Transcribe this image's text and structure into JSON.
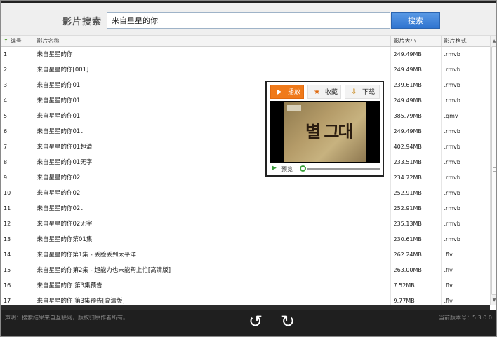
{
  "search": {
    "title": "影片搜索",
    "value": "来自星星的你",
    "button_label": "搜索"
  },
  "table": {
    "sort_icon": "↑",
    "headers": [
      "编号",
      "影片名称",
      "影片大小",
      "影片格式"
    ],
    "rows": [
      [
        "1",
        "来自星星的你",
        "249.49MB",
        ".rmvb"
      ],
      [
        "2",
        "来自星星的你[001]",
        "249.49MB",
        ".rmvb"
      ],
      [
        "3",
        "来自星星的你01",
        "239.61MB",
        ".rmvb"
      ],
      [
        "4",
        "来自星星的你01",
        "249.49MB",
        ".rmvb"
      ],
      [
        "5",
        "来自星星的你01",
        "385.79MB",
        ".qmv"
      ],
      [
        "6",
        "来自星星的你01t",
        "249.49MB",
        ".rmvb"
      ],
      [
        "7",
        "来自星星的你01超清",
        "402.94MB",
        ".rmvb"
      ],
      [
        "8",
        "来自星星的你01无字",
        "233.51MB",
        ".rmvb"
      ],
      [
        "9",
        "来自星星的你02",
        "234.72MB",
        ".rmvb"
      ],
      [
        "10",
        "来自星星的你02",
        "252.91MB",
        ".rmvb"
      ],
      [
        "11",
        "来自星星的你02t",
        "252.91MB",
        ".rmvb"
      ],
      [
        "12",
        "来自星星的你02无字",
        "235.13MB",
        ".rmvb"
      ],
      [
        "13",
        "来自星星的你第01集",
        "230.61MB",
        ".rmvb"
      ],
      [
        "14",
        "来自星星的你第1集 - 丢脸丢到太平洋",
        "262.24MB",
        ".flv"
      ],
      [
        "15",
        "来自星星的你第2集 - 超能力也未能帮上忙[高清版]",
        "263.00MB",
        ".flv"
      ],
      [
        "16",
        "来自星星的你 第3集预告",
        "7.52MB",
        ".flv"
      ],
      [
        "17",
        "来自星星的你 第3集预告[高清版]",
        "9.77MB",
        ".flv"
      ]
    ]
  },
  "popup": {
    "play_label": "播放",
    "favorite_label": "收藏",
    "download_label": "下载",
    "video_title": "별 그대",
    "preview_label": "预览",
    "play_icon": "▶",
    "favorite_icon": "★",
    "download_icon": "⇩",
    "preview_progress": 0
  },
  "footer": {
    "note": "声明：搜索结果来自互联网，版权归原作者所有。",
    "version": "当前版本号：5.3.0.0",
    "rotate_left_icon": "↺",
    "rotate_right_icon": "↻"
  },
  "colors": {
    "search_button": "#2f74d0",
    "play_tab": "#f07a1a",
    "footer_bg": "#1f1f1f"
  }
}
